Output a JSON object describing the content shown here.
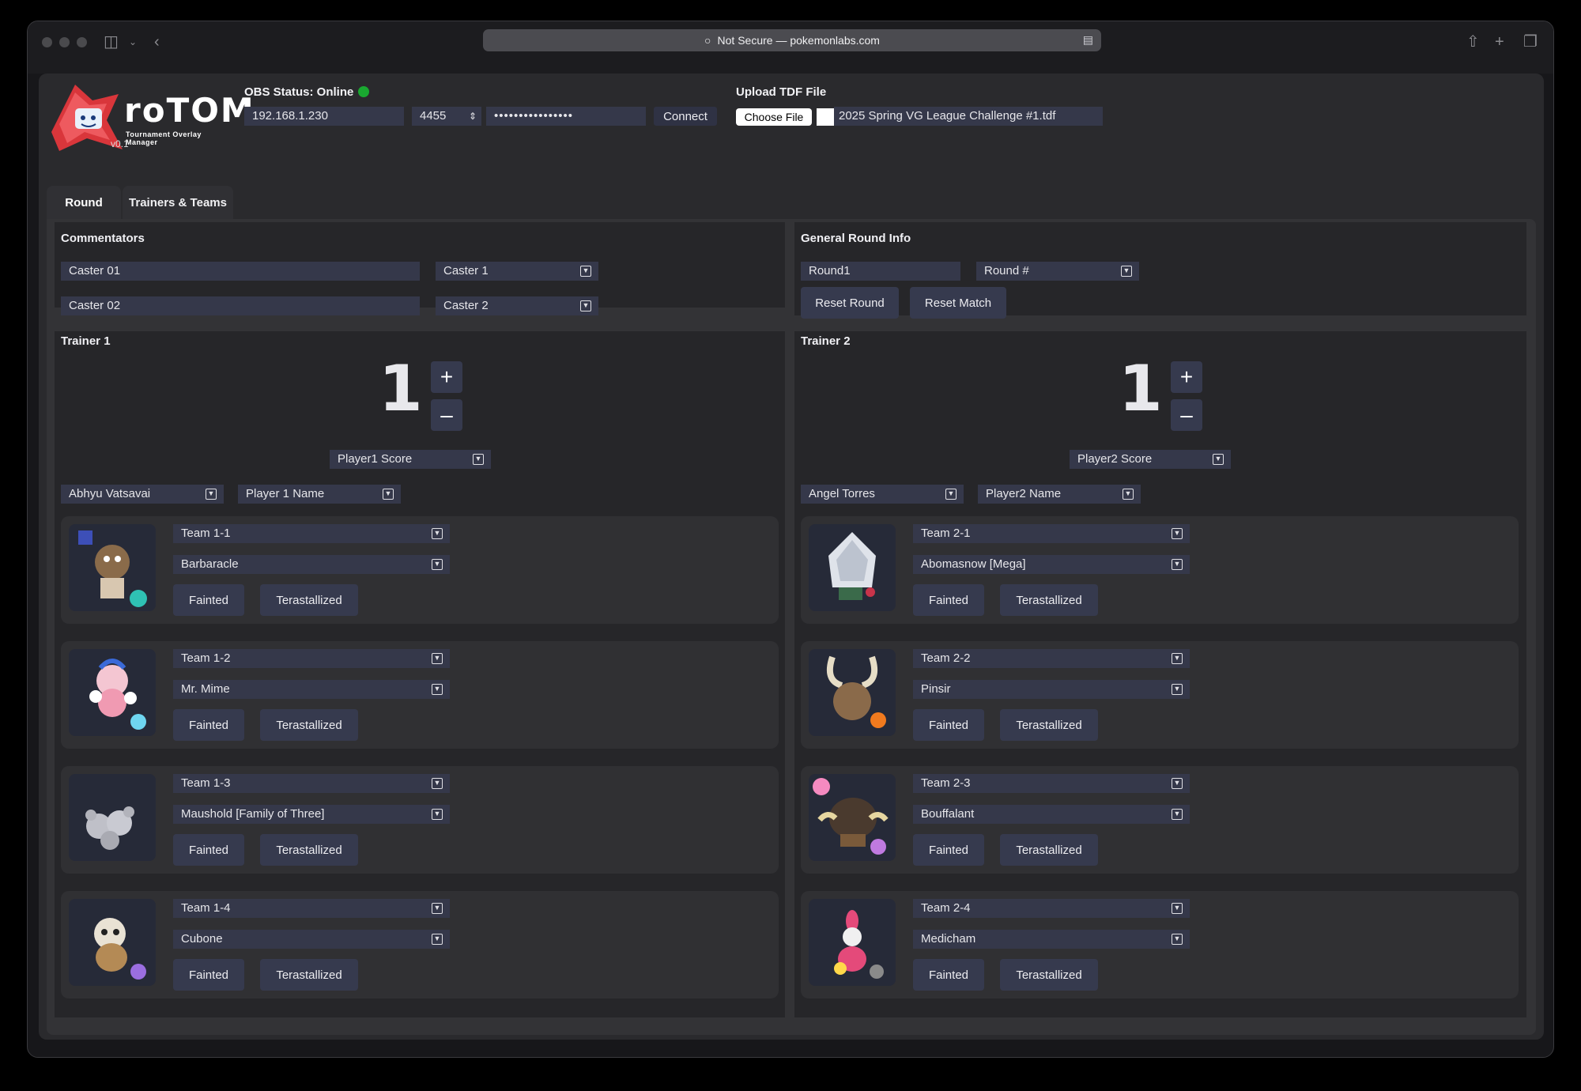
{
  "browser": {
    "url_text": "Not Secure — pokemonlabs.com"
  },
  "app": {
    "name": "roTOM",
    "subtitle": "Tournament Overlay Manager",
    "version": "v0.1"
  },
  "obs": {
    "status_label": "OBS Status: Online",
    "status_color": "#19a830",
    "ip": "192.168.1.230",
    "port": "4455",
    "password": "••••••••••••••••",
    "connect_label": "Connect"
  },
  "upload": {
    "label": "Upload TDF File",
    "choose_label": "Choose File",
    "filename": "2025 Spring VG League Challenge #1.tdf"
  },
  "tabs": [
    {
      "label": "Round",
      "active": true
    },
    {
      "label": "Trainers & Teams",
      "active": false
    }
  ],
  "commentators": {
    "title": "Commentators",
    "rows": [
      {
        "name": "Caster 01",
        "select": "Caster 1"
      },
      {
        "name": "Caster 02",
        "select": "Caster 2"
      }
    ]
  },
  "round_info": {
    "title": "General Round Info",
    "round_value": "Round1",
    "round_select": "Round #",
    "reset_round": "Reset Round",
    "reset_match": "Reset Match"
  },
  "trainers": [
    {
      "title": "Trainer 1",
      "score": "1",
      "plus": "+",
      "minus": "–",
      "score_select": "Player1 Score",
      "name": "Abhyu Vatsavai",
      "name_select": "Player 1 Name",
      "team": [
        {
          "slot": "Team 1-1",
          "pokemon": "Barbaracle",
          "fainted": "Fainted",
          "tera": "Terastallized",
          "icon": "barbaracle-sprite"
        },
        {
          "slot": "Team 1-2",
          "pokemon": "Mr. Mime",
          "fainted": "Fainted",
          "tera": "Terastallized",
          "icon": "mr-mime-sprite"
        },
        {
          "slot": "Team 1-3",
          "pokemon": "Maushold [Family of Three]",
          "fainted": "Fainted",
          "tera": "Terastallized",
          "icon": "maushold-sprite"
        },
        {
          "slot": "Team 1-4",
          "pokemon": "Cubone",
          "fainted": "Fainted",
          "tera": "Terastallized",
          "icon": "cubone-sprite"
        }
      ]
    },
    {
      "title": "Trainer 2",
      "score": "1",
      "plus": "+",
      "minus": "–",
      "score_select": "Player2 Score",
      "name": "Angel Torres",
      "name_select": "Player2 Name",
      "team": [
        {
          "slot": "Team 2-1",
          "pokemon": "Abomasnow [Mega]",
          "fainted": "Fainted",
          "tera": "Terastallized",
          "icon": "abomasnow-sprite"
        },
        {
          "slot": "Team 2-2",
          "pokemon": "Pinsir",
          "fainted": "Fainted",
          "tera": "Terastallized",
          "icon": "pinsir-sprite"
        },
        {
          "slot": "Team 2-3",
          "pokemon": "Bouffalant",
          "fainted": "Fainted",
          "tera": "Terastallized",
          "icon": "bouffalant-sprite"
        },
        {
          "slot": "Team 2-4",
          "pokemon": "Medicham",
          "fainted": "Fainted",
          "tera": "Terastallized",
          "icon": "medicham-sprite"
        }
      ]
    }
  ]
}
